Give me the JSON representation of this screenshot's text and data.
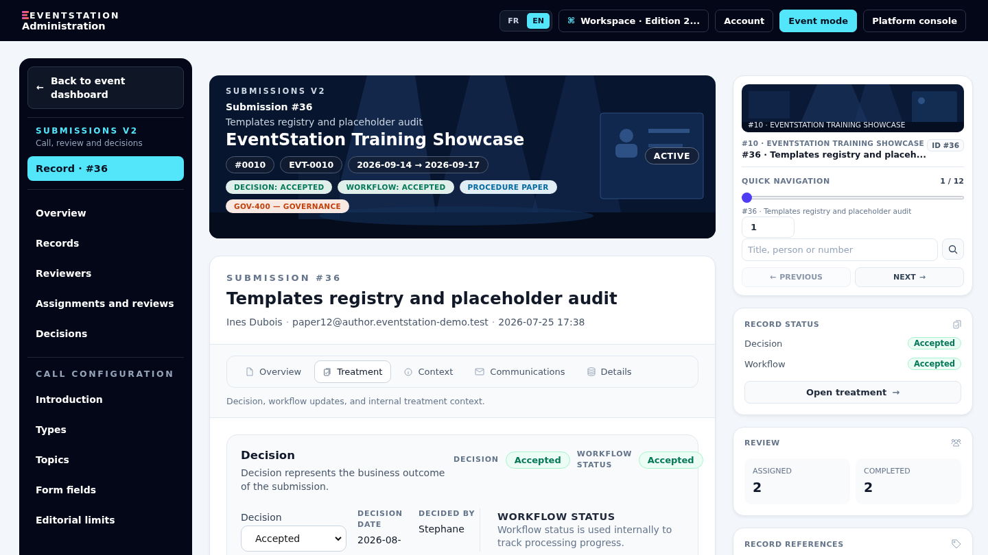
{
  "header": {
    "brand": "EVENTSTATION",
    "subtitle": "Administration",
    "languages": [
      {
        "label": "FR",
        "selected": false
      },
      {
        "label": "EN",
        "selected": true
      }
    ],
    "workspace": {
      "icon": "⌘",
      "label": "Workspace · Edition 2..."
    },
    "buttons": [
      {
        "label": "Account",
        "selected": false
      },
      {
        "label": "Event mode",
        "selected": true
      },
      {
        "label": "Platform console",
        "selected": false
      }
    ]
  },
  "sidebar": {
    "back": "Back to event dashboard",
    "back_icon": "←",
    "section": "SUBMISSIONS V2",
    "section_sub": "Call, review and decisions",
    "record": {
      "label": "Record · #36",
      "selected": true
    },
    "items": [
      {
        "label": "Overview",
        "selected": false
      },
      {
        "label": "Records",
        "selected": false
      },
      {
        "label": "Reviewers",
        "selected": false
      },
      {
        "label": "Assignments and reviews",
        "selected": false
      },
      {
        "label": "Decisions",
        "selected": false
      }
    ],
    "config_title": "CALL CONFIGURATION",
    "config_items": [
      {
        "label": "Introduction",
        "selected": false
      },
      {
        "label": "Types",
        "selected": false
      },
      {
        "label": "Topics",
        "selected": false
      },
      {
        "label": "Form fields",
        "selected": false
      },
      {
        "label": "Editorial limits",
        "selected": false
      }
    ]
  },
  "hero": {
    "eyebrow": "SUBMISSIONS V2",
    "submission": "Submission #36",
    "subtitle": "Templates registry and placeholder audit",
    "title": "EventStation Training Showcase",
    "status": "ACTIVE",
    "chips": [
      "#0010",
      "EVT-0010",
      "2026-09-14 → 2026-09-17"
    ],
    "tags": [
      {
        "label": "DECISION: ACCEPTED",
        "color": "#047857"
      },
      {
        "label": "WORKFLOW: ACCEPTED",
        "color": "#047857"
      },
      {
        "label": "PROCEDURE PAPER",
        "color": "#0369a1"
      },
      {
        "label": "GOV-400 — GOVERNANCE",
        "color": "#c2410c"
      }
    ]
  },
  "submission": {
    "eyebrow": "SUBMISSION #36",
    "title": "Templates registry and placeholder audit",
    "author": "Ines Dubois",
    "email": "paper12@author.eventstation-demo.test",
    "date": "2026-07-25 17:38",
    "separator": "·",
    "tabs": [
      {
        "label": "Overview",
        "selected": false
      },
      {
        "label": "Treatment",
        "selected": true
      },
      {
        "label": "Context",
        "selected": false
      },
      {
        "label": "Communications",
        "selected": false
      },
      {
        "label": "Details",
        "selected": false
      }
    ],
    "tab_hint": "Decision, workflow updates, and internal treatment context.",
    "decision": {
      "title": "Decision",
      "description": "Decision represents the business outcome of the submission.",
      "badge_label": "DECISION",
      "badge": "Accepted",
      "workflow_label": "WORKFLOW STATUS",
      "workflow_badge": "Accepted",
      "select_label": "Decision",
      "select_value": "Accepted",
      "date_label": "DECISION DATE",
      "date_value": "2026-08-",
      "by_label": "DECIDED BY",
      "by_value": "Stephane",
      "workflow_title": "WORKFLOW STATUS",
      "workflow_text": "Workflow status is used internally to track processing progress."
    }
  },
  "right": {
    "picture_caption": "#10 · EVENTSTATION TRAINING SHOWCASE",
    "event": "#10 · EVENTSTATION TRAINING SHOWCASE",
    "id": "ID #36",
    "record": "#36 · Templates registry and placeh...",
    "nav_title": "QUICK NAVIGATION",
    "nav_count": "1 / 12",
    "level": 0,
    "nav_caption": "#36 · Templates registry and placeholder audit",
    "page_value": "1",
    "search_placeholder": "Title, person or number",
    "previous": {
      "label": "PREVIOUS",
      "icon": "←",
      "disabled": true
    },
    "next": {
      "label": "NEXT",
      "icon": "→",
      "disabled": false
    },
    "status_title": "RECORD STATUS",
    "status_rows": [
      {
        "label": "Decision",
        "value": "Accepted"
      },
      {
        "label": "Workflow",
        "value": "Accepted"
      }
    ],
    "open": "Open treatment",
    "open_icon": "→",
    "review_title": "REVIEW",
    "stats": [
      {
        "label": "ASSIGNED",
        "value": "2"
      },
      {
        "label": "COMPLETED",
        "value": "2"
      }
    ],
    "references_title": "RECORD REFERENCES"
  }
}
